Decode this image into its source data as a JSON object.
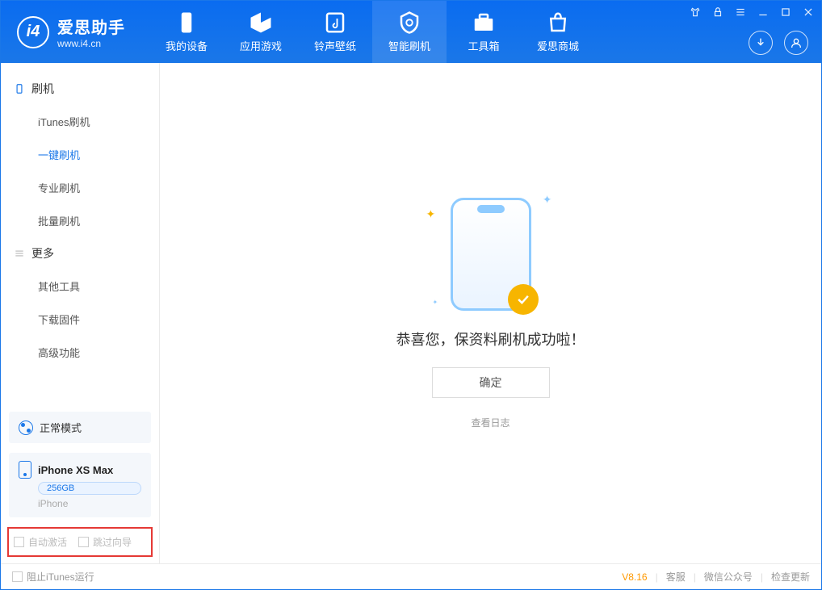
{
  "app": {
    "title": "爱思助手",
    "url": "www.i4.cn"
  },
  "nav": {
    "tabs": [
      {
        "label": "我的设备"
      },
      {
        "label": "应用游戏"
      },
      {
        "label": "铃声壁纸"
      },
      {
        "label": "智能刷机"
      },
      {
        "label": "工具箱"
      },
      {
        "label": "爱思商城"
      }
    ]
  },
  "sidebar": {
    "group_flash": {
      "title": "刷机",
      "items": [
        "iTunes刷机",
        "一键刷机",
        "专业刷机",
        "批量刷机"
      ]
    },
    "group_more": {
      "title": "更多",
      "items": [
        "其他工具",
        "下载固件",
        "高级功能"
      ]
    }
  },
  "mode": {
    "label": "正常模式"
  },
  "device": {
    "name": "iPhone XS Max",
    "storage": "256GB",
    "type": "iPhone"
  },
  "options": {
    "auto_activate": "自动激活",
    "skip_guide": "跳过向导"
  },
  "main": {
    "success_text": "恭喜您，保资料刷机成功啦！",
    "confirm": "确定",
    "view_log": "查看日志"
  },
  "statusbar": {
    "block_itunes": "阻止iTunes运行",
    "version": "V8.16",
    "links": [
      "客服",
      "微信公众号",
      "检查更新"
    ]
  }
}
